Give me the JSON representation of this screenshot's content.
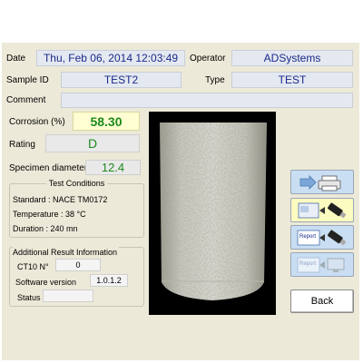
{
  "header": {
    "date_label": "Date",
    "date_value": "Thu, Feb 06, 2014  12:03:49",
    "operator_label": "Operator",
    "operator_value": "ADSystems",
    "sample_id_label": "Sample ID",
    "sample_id_value": "TEST2",
    "type_label": "Type",
    "type_value": "TEST",
    "comment_label": "Comment",
    "comment_value": ""
  },
  "results": {
    "corrosion_label": "Corrosion (%)",
    "corrosion_value": "58.30",
    "rating_label": "Rating",
    "rating_value": "D",
    "diameter_label": "Specimen diameter",
    "diameter_value": "12.4"
  },
  "test_conditions": {
    "title": "Test Conditions",
    "standard": "Standard : NACE TM0172",
    "temperature": "Temperature : 38 °C",
    "duration": "Duration : 240 mn"
  },
  "additional": {
    "title": "Additional Result Information",
    "ct10_label": "CT10 N°",
    "ct10_value": "0",
    "software_label": "Software version",
    "software_value": "1.0.1.2",
    "status_label": "Status",
    "status_value": ""
  },
  "side_buttons": [
    {
      "icon": "print-icon",
      "report_text": ""
    },
    {
      "icon": "save-to-usb-icon",
      "report_text": ""
    },
    {
      "icon": "report-to-usb-icon",
      "report_text": "Report"
    },
    {
      "icon": "report-to-computer-icon",
      "report_text": "Report"
    }
  ],
  "back_label": "Back",
  "colors": {
    "panel_bg": "#ece9d8",
    "field_bg": "#e4e8f0",
    "value_blue": "#1a2a8a",
    "value_green": "#1d8a1d",
    "highlight_yellow": "#fffed2"
  }
}
